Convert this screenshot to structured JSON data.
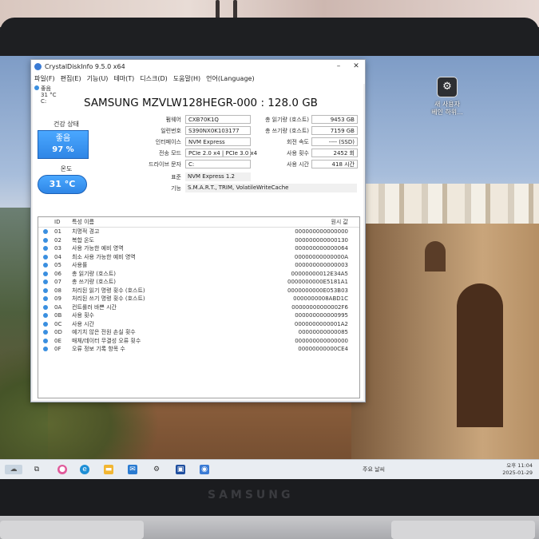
{
  "window": {
    "title": "CrystalDiskInfo 9.5.0 x64",
    "menu": [
      "파일(F)",
      "편집(E)",
      "기능(U)",
      "테마(T)",
      "디스크(D)",
      "도움말(H)",
      "언어(Language)"
    ],
    "status_strip": {
      "state": "좋음",
      "temp": "31 °C",
      "drive": "C:"
    },
    "model": "SAMSUNG MZVLW128HEGR-000 : 128.0 GB",
    "health": {
      "label": "건강 상태",
      "status": "좋음",
      "percent": "97 %"
    },
    "temperature": {
      "label": "온도",
      "value": "31 °C"
    },
    "left_fields": [
      {
        "label": "펌웨어",
        "value": "CXB70K1Q"
      },
      {
        "label": "일련번호",
        "value": "S390NX0K103177"
      },
      {
        "label": "인터페이스",
        "value": "NVM Express"
      },
      {
        "label": "전송 모드",
        "value": "PCIe 2.0 x4 | PCIe 3.0 x4"
      },
      {
        "label": "드라이브 문자",
        "value": "C:"
      },
      {
        "label": "표준",
        "value": "NVM Express 1.2"
      },
      {
        "label": "기능",
        "value": "S.M.A.R.T., TRIM, VolatileWriteCache"
      }
    ],
    "right_fields": [
      {
        "label": "총 읽기량 (호스트)",
        "value": "9453 GB"
      },
      {
        "label": "총 쓰기량 (호스트)",
        "value": "7159 GB"
      },
      {
        "label": "회전 속도",
        "value": "---- (SSD)"
      },
      {
        "label": "사용 횟수",
        "value": "2452 회"
      },
      {
        "label": "사용 시간",
        "value": "418 시간"
      }
    ],
    "attributes_header": {
      "id": "ID",
      "name": "특성 이름",
      "raw": "원시 값"
    },
    "attributes": [
      {
        "id": "01",
        "name": "치명적 경고",
        "raw": "000000000000000"
      },
      {
        "id": "02",
        "name": "복합 온도",
        "raw": "000000000000130"
      },
      {
        "id": "03",
        "name": "사용 가능한 예비 영역",
        "raw": "000000000000064"
      },
      {
        "id": "04",
        "name": "최소 사용 가능한 예비 영역",
        "raw": "00000000000000A"
      },
      {
        "id": "05",
        "name": "사용률",
        "raw": "000000000000003"
      },
      {
        "id": "06",
        "name": "총 읽기량 (호스트)",
        "raw": "00000000012E34A5"
      },
      {
        "id": "07",
        "name": "총 쓰기량 (호스트)",
        "raw": "0000000000E5181A1"
      },
      {
        "id": "08",
        "name": "처리된 읽기 명령 횟수 (호스트)",
        "raw": "0000000000E053B03"
      },
      {
        "id": "09",
        "name": "처리된 쓰기 명령 횟수 (호스트)",
        "raw": "0000000008ABD1C"
      },
      {
        "id": "0A",
        "name": "컨트롤러 바쁜 시간",
        "raw": "00000000000002F6"
      },
      {
        "id": "0B",
        "name": "사용 횟수",
        "raw": "000000000000995"
      },
      {
        "id": "0C",
        "name": "사용 시간",
        "raw": "0000000000001A2"
      },
      {
        "id": "0D",
        "name": "예기치 않은 전원 손실 횟수",
        "raw": "00000000000085"
      },
      {
        "id": "0E",
        "name": "매체/데이터 무결성 오류 횟수",
        "raw": "000000000000000"
      },
      {
        "id": "0F",
        "name": "오류 정보 기록 항목 수",
        "raw": "00000000000CE4"
      }
    ]
  },
  "desktop_icon": {
    "label": "새 사용자\n베인 하위..."
  },
  "taskbar": {
    "weather": "주요 날씨",
    "time": "오후 11:04",
    "date": "2025-01-29"
  },
  "colors": {
    "health_blue": "#2f86e6",
    "dot_blue": "#3a8fe0"
  }
}
